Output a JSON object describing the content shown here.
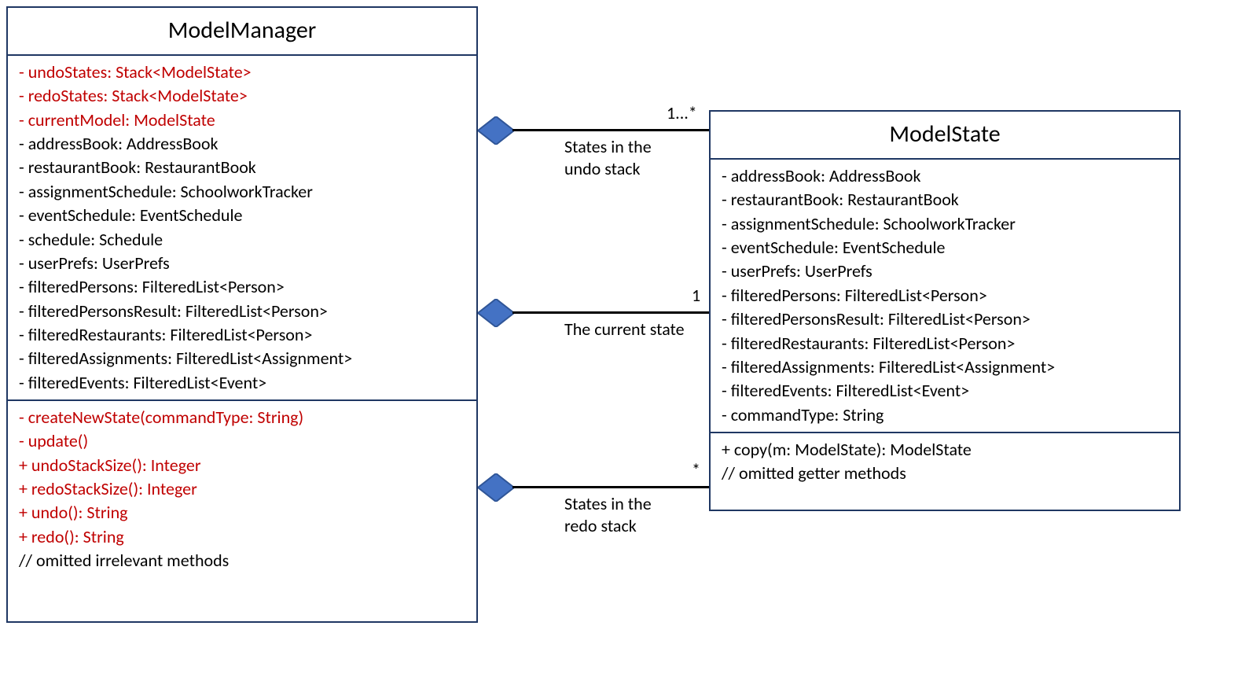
{
  "classes": {
    "modelManager": {
      "name": "ModelManager",
      "attrs_red": [
        "- undoStates: Stack<ModelState>",
        "- redoStates: Stack<ModelState>",
        "- currentModel: ModelState"
      ],
      "attrs_black": [
        "- addressBook: AddressBook",
        "- restaurantBook: RestaurantBook",
        "- assignmentSchedule: SchoolworkTracker",
        "- eventSchedule: EventSchedule",
        "- schedule: Schedule",
        "- userPrefs: UserPrefs",
        "- filteredPersons: FilteredList<Person>",
        "- filteredPersonsResult: FilteredList<Person>",
        "- filteredRestaurants: FilteredList<Person>",
        "- filteredAssignments: FilteredList<Assignment>",
        "- filteredEvents: FilteredList<Event>"
      ],
      "methods_red": [
        "- createNewState(commandType: String)",
        "- update()",
        "+ undoStackSize(): Integer",
        "+ redoStackSize(): Integer",
        "+ undo(): String",
        "+ redo(): String"
      ],
      "methods_black": [
        "// omitted irrelevant methods"
      ]
    },
    "modelState": {
      "name": "ModelState",
      "attrs": [
        "- addressBook: AddressBook",
        "- restaurantBook: RestaurantBook",
        "- assignmentSchedule: SchoolworkTracker",
        "- eventSchedule: EventSchedule",
        "- userPrefs: UserPrefs",
        "- filteredPersons: FilteredList<Person>",
        "- filteredPersonsResult: FilteredList<Person>",
        "- filteredRestaurants: FilteredList<Person>",
        "- filteredAssignments: FilteredList<Assignment>",
        "- filteredEvents: FilteredList<Event>",
        "- commandType: String"
      ],
      "methods": [
        "+ copy(m: ModelState): ModelState",
        "// omitted getter methods"
      ]
    }
  },
  "associations": {
    "undo": {
      "mult": "1...*",
      "label_l1": "States in the",
      "label_l2": "undo stack"
    },
    "current": {
      "mult": "1",
      "label_l1": "The current state"
    },
    "redo": {
      "mult": "*",
      "label_l1": "States in the",
      "label_l2": "redo stack"
    }
  }
}
